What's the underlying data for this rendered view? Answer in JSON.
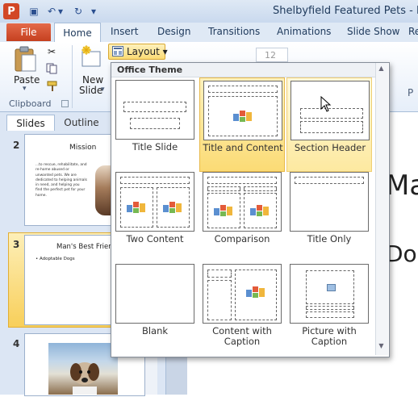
{
  "window": {
    "title": "Shelbyfield Featured Pets - Le",
    "app_icon": "P"
  },
  "qat": [
    {
      "name": "save-icon",
      "glyph": "▣"
    },
    {
      "name": "undo-icon",
      "glyph": "↶"
    },
    {
      "name": "undo-dropdown-icon",
      "glyph": "▾"
    },
    {
      "name": "redo-icon",
      "glyph": "↻"
    },
    {
      "name": "customize-qat-icon",
      "glyph": "▾"
    }
  ],
  "ribbon_tabs": {
    "file": "File",
    "home": "Home",
    "insert": "Insert",
    "design": "Design",
    "transitions": "Transitions",
    "animations": "Animations",
    "slideshow": "Slide Show",
    "review": "Re"
  },
  "ribbon": {
    "paste": "Paste",
    "clipboard": "Clipboard",
    "new_slide_1": "New",
    "new_slide_2": "Slide",
    "new_slide_arrow": "▾",
    "paste_arrow": "▾",
    "layout_button": "Layout ▾",
    "font_size": "12",
    "par_group": "P"
  },
  "pane": {
    "tab_slides": "Slides",
    "tab_outline": "Outline",
    "close": "×",
    "slides": [
      {
        "num": "2",
        "title": "Mission",
        "bullet": "...to rescue, rehabilitate, and re-home abused or unwanted pets. We are dedicated to helping animals in need, and helping you find the perfect pet for your home."
      },
      {
        "num": "3",
        "title": "Man's Best Friend",
        "bullet": "• Adoptable Dogs"
      },
      {
        "num": "4"
      }
    ]
  },
  "main": {
    "text1": "Mar",
    "text2": "Dog"
  },
  "gallery": {
    "header": "Office Theme",
    "layouts": [
      {
        "label": "Title Slide"
      },
      {
        "label": "Title and Content"
      },
      {
        "label": "Section Header"
      },
      {
        "label": "Two Content"
      },
      {
        "label": "Comparison"
      },
      {
        "label": "Title Only"
      },
      {
        "label": "Blank"
      },
      {
        "label": "Content with Caption"
      },
      {
        "label": "Picture with Caption"
      }
    ],
    "scroll_up": "▲",
    "scroll_down": "▼"
  },
  "colors": {
    "file_tab": "#c5401f",
    "selection": "#fbdb75",
    "app_icon": "#d24726"
  }
}
